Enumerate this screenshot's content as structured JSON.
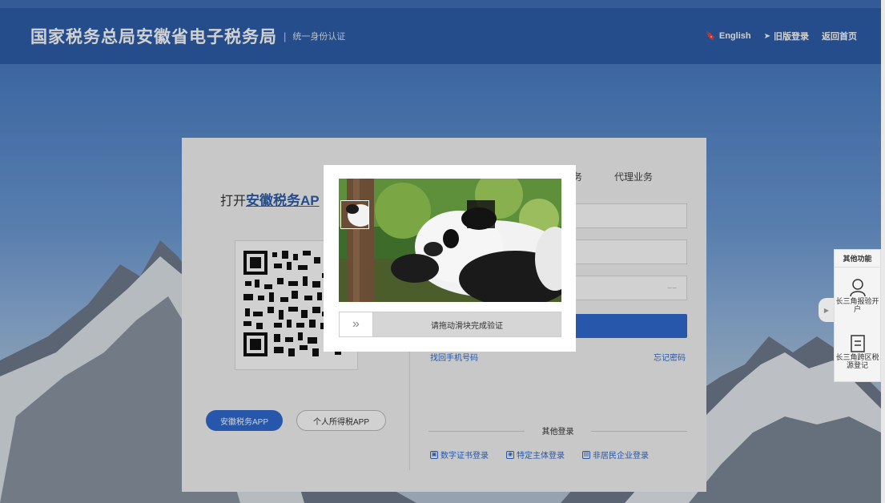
{
  "header": {
    "title": "国家税务总局安徽省电子税务局",
    "subtitle": "统一身份认证",
    "links": [
      {
        "label": "English",
        "icon": "english-icon"
      },
      {
        "label": "旧版登录",
        "icon": "send-icon"
      },
      {
        "label": "返回首页",
        "icon": ""
      }
    ]
  },
  "login": {
    "open_prefix": "打开",
    "app_name": "安徽税务AP",
    "tabs": [
      "务",
      "代理业务"
    ],
    "find_phone": "找回手机号码",
    "forgot_password": "忘记密码",
    "app_buttons": [
      "安徽税务APP",
      "个人所得税APP"
    ],
    "other_title": "其他登录",
    "other_options": [
      "数字证书登录",
      "特定主体登录",
      "非居民企业登录"
    ]
  },
  "captcha": {
    "hint": "请拖动滑块完成验证",
    "handle_icon": "double-chevron-right-icon"
  },
  "side_panel": {
    "title": "其他功能",
    "items": [
      {
        "label": "长三角报验开户",
        "icon": "user-icon"
      },
      {
        "label": "长三角跨区税源登记",
        "icon": "document-icon"
      }
    ]
  }
}
